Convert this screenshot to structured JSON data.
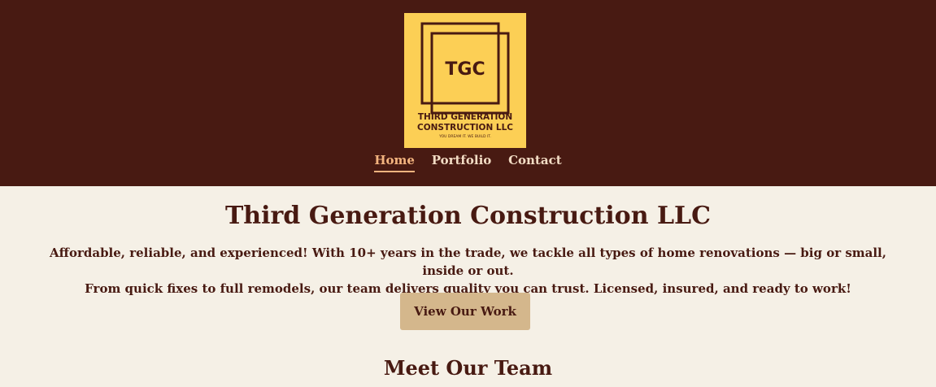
{
  "brand": {
    "monogram": "TGC",
    "name_line1": "THIRD GENERATION",
    "name_line2": "CONSTRUCTION LLC",
    "tagline": "YOU DREAM IT. WE BUILD IT."
  },
  "nav": {
    "items": [
      {
        "label": "Home",
        "active": true
      },
      {
        "label": "Portfolio",
        "active": false
      },
      {
        "label": "Contact",
        "active": false
      }
    ]
  },
  "hero": {
    "title": "Third Generation Construction LLC",
    "line1": "Affordable, reliable, and experienced! With 10+ years in the trade, we tackle all types of home renovations — big or small, inside or out.",
    "line2": "From quick fixes to full remodels, our team delivers quality you can trust. Licensed, insured, and ready to work!",
    "cta_label": "View Our Work"
  },
  "team": {
    "title": "Meet Our Team"
  },
  "colors": {
    "header_bg": "#481a12",
    "logo_bg": "#fccf55",
    "page_bg": "#f5f0e6",
    "accent": "#f3b47f",
    "button_bg": "#d4b78c",
    "text": "#481a12"
  }
}
